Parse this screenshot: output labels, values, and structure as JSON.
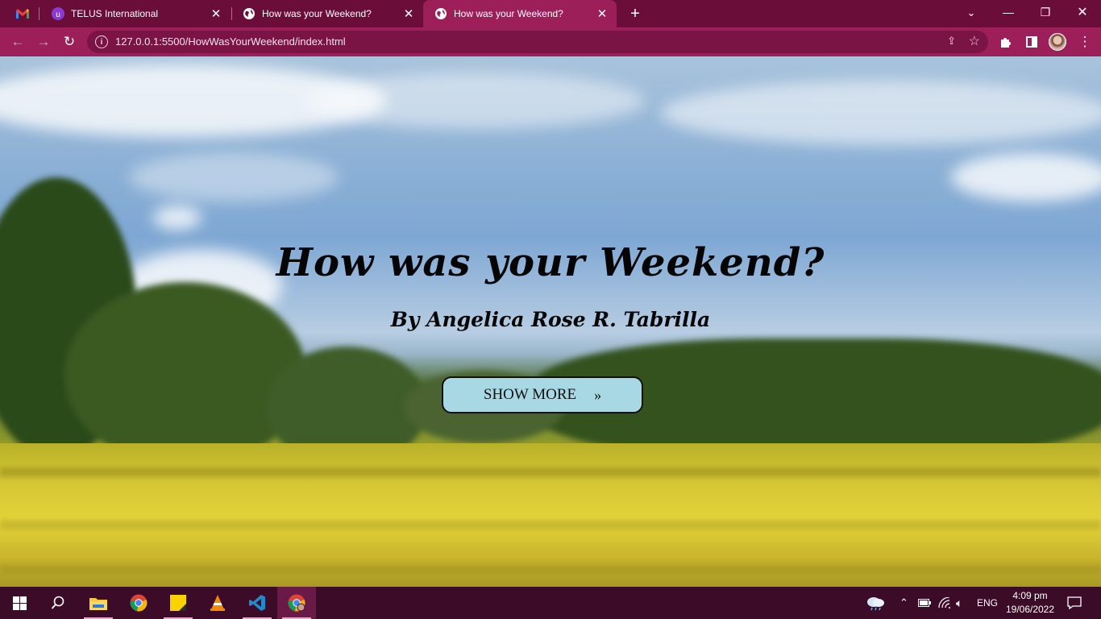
{
  "browser": {
    "tabs": [
      {
        "title": "TELUS International",
        "icon": "telus-icon"
      },
      {
        "title": "How was your Weekend?",
        "icon": "globe-icon"
      },
      {
        "title": "How was your Weekend?",
        "icon": "globe-icon",
        "active": true
      }
    ],
    "pinned_icon": "gmail-icon",
    "url": "127.0.0.1:5500/HowWasYourWeekend/index.html",
    "theme_color": "#9c1f5a"
  },
  "hero": {
    "title": "How was your Weekend?",
    "subtitle": "By Angelica Rose R. Tabrilla",
    "button_label": "SHOW MORE",
    "button_chevron": "»",
    "button_color": "#a8d8e3"
  },
  "taskbar": {
    "apps": [
      "start-icon",
      "search-icon",
      "file-explorer-icon",
      "chrome-icon",
      "sticky-notes-icon",
      "vlc-icon",
      "vscode-icon",
      "chrome-profile-icon"
    ],
    "language": "ENG",
    "time": "4:09 pm",
    "date": "19/06/2022"
  }
}
